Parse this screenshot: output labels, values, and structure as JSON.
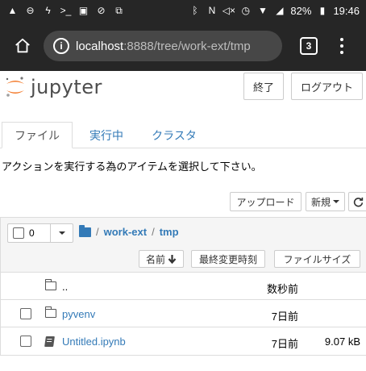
{
  "status_bar": {
    "left_icons": [
      "warning-icon",
      "do-not-disturb-icon",
      "flash-icon",
      "terminal-icon",
      "screen-icon",
      "no-sync-icon",
      "screenshot-icon"
    ],
    "right_icons": [
      "bluetooth-icon",
      "nfc-icon",
      "mute-icon",
      "alarm-icon",
      "wifi-icon",
      "signal-icon",
      "battery-icon"
    ],
    "battery": "82%",
    "time": "19:46"
  },
  "browser": {
    "url_host": "localhost",
    "url_path": ":8888/tree/work-ext/tmp",
    "tab_count": "3"
  },
  "header": {
    "logo_text": "jupyter",
    "quit_label": "終了",
    "logout_label": "ログアウト"
  },
  "tabs": [
    {
      "label": "ファイル",
      "active": true
    },
    {
      "label": "実行中",
      "active": false
    },
    {
      "label": "クラスタ",
      "active": false
    }
  ],
  "hint_text": "アクションを実行する為のアイテムを選択して下さい。",
  "actions": {
    "upload_label": "アップロード",
    "new_label": "新規"
  },
  "list": {
    "selected_count": "0",
    "breadcrumb": [
      "/",
      "work-ext",
      "/",
      "tmp"
    ],
    "sort_name_label": "名前",
    "sort_time_label": "最終変更時刻",
    "sort_size_label": "ファイルサイズ",
    "items": [
      {
        "name": "..",
        "modified": "数秒前",
        "size": "",
        "type": "parent"
      },
      {
        "name": "pyvenv",
        "modified": "7日前",
        "size": "",
        "type": "folder"
      },
      {
        "name": "Untitled.ipynb",
        "modified": "7日前",
        "size": "9.07 kB",
        "type": "notebook"
      }
    ]
  }
}
